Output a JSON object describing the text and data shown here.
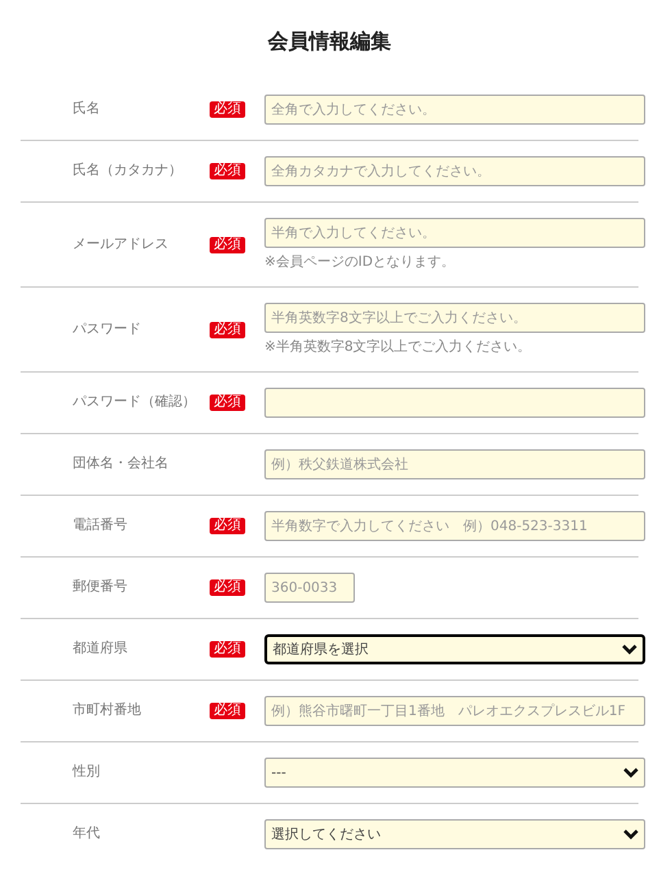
{
  "title": "会員情報編集",
  "rows": [
    {
      "label": "氏名",
      "badge": "必須",
      "field": {
        "kind": "text",
        "placeholder": "全角で入力してください。",
        "focused": false
      }
    },
    {
      "label": "氏名（カタカナ）",
      "badge": "必須",
      "field": {
        "kind": "text",
        "placeholder": "全角カタカナで入力してください。",
        "focused": false
      }
    },
    {
      "label": "メールアドレス",
      "badge": "必須",
      "field": {
        "kind": "text",
        "placeholder": "半角で入力してください。",
        "focused": false
      },
      "note": "※会員ページのIDとなります。"
    },
    {
      "label": "パスワード",
      "badge": "必須",
      "field": {
        "kind": "text",
        "placeholder": "半角英数字8文字以上でご入力ください。",
        "focused": false
      },
      "note": "※半角英数字8文字以上でご入力ください。"
    },
    {
      "label": "パスワード（確認）",
      "badge": "必須",
      "field": {
        "kind": "text",
        "focused": false
      }
    },
    {
      "label": "団体名・会社名",
      "field": {
        "kind": "text",
        "placeholder": "例）秩父鉄道株式会社",
        "focused": false
      }
    },
    {
      "label": "電話番号",
      "badge": "必須",
      "field": {
        "kind": "text",
        "placeholder": "半角数字で入力してください　例）048-523-3311",
        "focused": false
      }
    },
    {
      "label": "郵便番号",
      "badge": "必須",
      "field": {
        "kind": "short-text",
        "placeholder": "360-0033",
        "focused": false
      }
    },
    {
      "label": "都道府県",
      "badge": "必須",
      "field": {
        "kind": "select",
        "value": "都道府県を選択",
        "focused": true
      }
    },
    {
      "label": "市町村番地",
      "badge": "必須",
      "field": {
        "kind": "text",
        "placeholder": "例）熊谷市曙町一丁目1番地　パレオエクスプレスビル1F",
        "focused": false
      }
    },
    {
      "label": "性別",
      "field": {
        "kind": "select",
        "value": "---",
        "focused": false
      }
    },
    {
      "label": "年代",
      "field": {
        "kind": "select",
        "value": "選択してください",
        "focused": false
      }
    }
  ]
}
